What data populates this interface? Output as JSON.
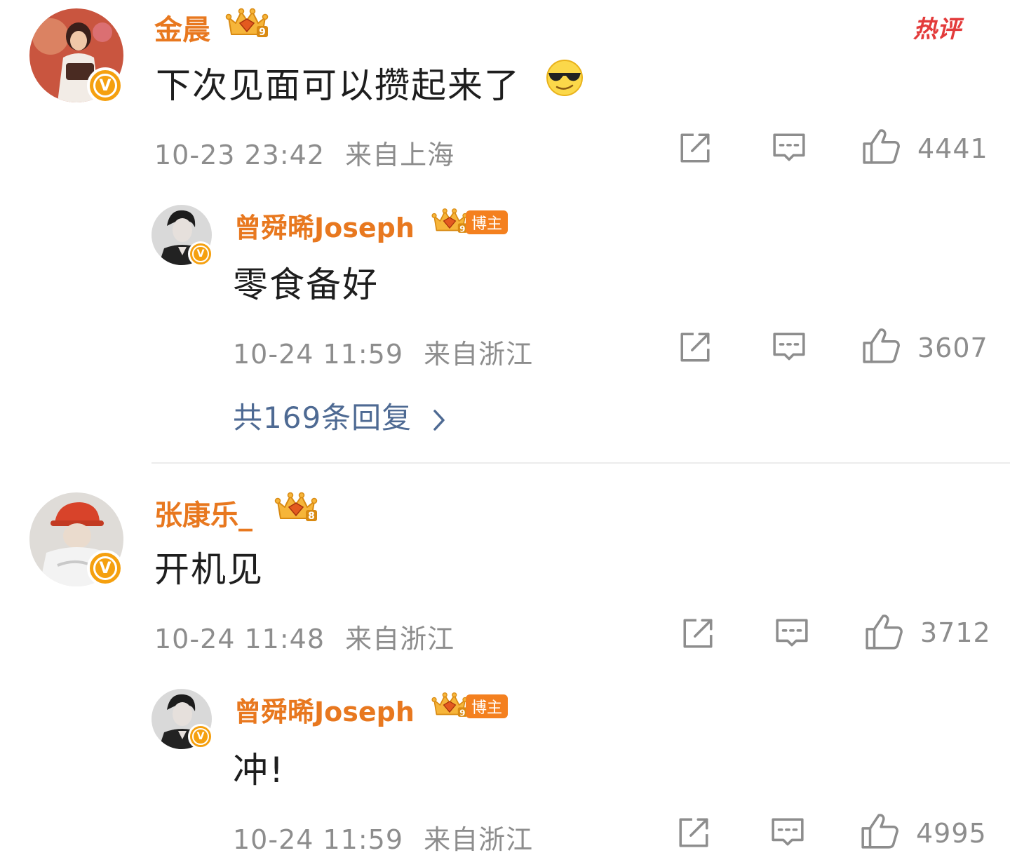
{
  "hot_label": "热评",
  "comments": [
    {
      "user": "金晨",
      "level": "9",
      "text": "下次见面可以攒起来了",
      "emoji": "sunglasses-face",
      "time": "10-23 23:42",
      "location": "来自上海",
      "likes": "4441",
      "reply": {
        "user": "曾舜晞Joseph",
        "level": "9",
        "host_label": "博主",
        "text": "零食备好",
        "time": "10-24 11:59",
        "location": "来自浙江",
        "likes": "3607"
      },
      "more_replies": "共169条回复"
    },
    {
      "user": "张康乐_",
      "level": "8",
      "text": "开机见",
      "time": "10-24 11:48",
      "location": "来自浙江",
      "likes": "3712",
      "reply": {
        "user": "曾舜晞Joseph",
        "level": "9",
        "host_label": "博主",
        "text": "冲!",
        "time": "10-24 11:59",
        "location": "来自浙江",
        "likes": "4995"
      }
    }
  ],
  "colors": {
    "username": "#e8781f",
    "meta": "#8d8d8d",
    "link": "#4e6a93",
    "verified_badge": "#f5a00f",
    "hot": "#e33b3b"
  }
}
